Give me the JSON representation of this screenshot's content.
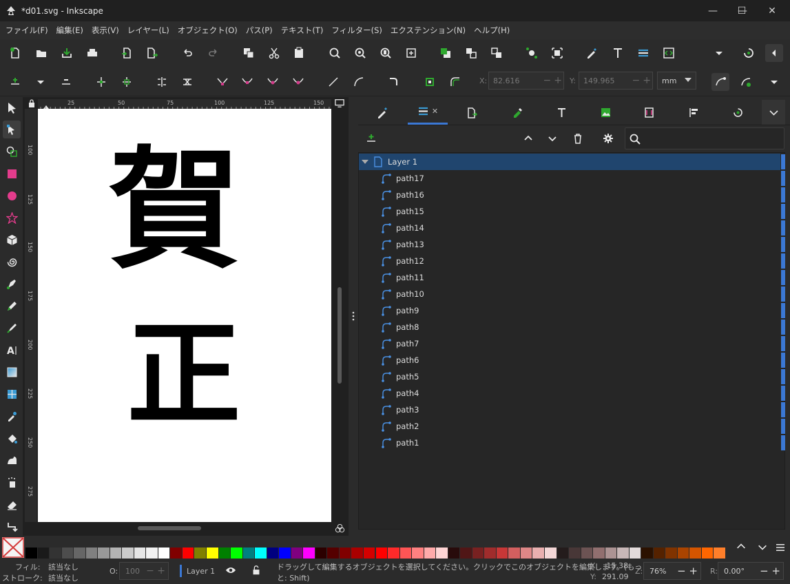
{
  "window": {
    "title": "*d01.svg - Inkscape",
    "minimize": "—",
    "maximize": "☐",
    "close": "✕"
  },
  "menu": [
    "ファイル(F)",
    "編集(E)",
    "表示(V)",
    "レイヤー(L)",
    "オブジェクト(O)",
    "パス(P)",
    "テキスト(T)",
    "フィルター(S)",
    "エクステンション(N)",
    "ヘルプ(H)"
  ],
  "controls": {
    "x_label": "X:",
    "x_value": "82.616",
    "y_label": "Y:",
    "y_value": "149.965",
    "unit": "mm"
  },
  "rulers": {
    "h_ticks": [
      "25",
      "50",
      "75",
      "100",
      "125",
      "150"
    ],
    "v_ticks": [
      "100",
      "125",
      "150",
      "175",
      "200",
      "225",
      "250",
      "275"
    ]
  },
  "canvas": {
    "glyph_top": "賀",
    "glyph_bottom": "正"
  },
  "dock": {
    "active_tab_close": "✕",
    "layer_name": "Layer 1",
    "paths": [
      "path17",
      "path16",
      "path15",
      "path14",
      "path13",
      "path12",
      "path11",
      "path10",
      "path9",
      "path8",
      "path7",
      "path6",
      "path5",
      "path4",
      "path3",
      "path2",
      "path1"
    ]
  },
  "palette": {
    "colors": [
      "#000000",
      "#1a1a1a",
      "#333333",
      "#4d4d4d",
      "#666666",
      "#808080",
      "#999999",
      "#b3b3b3",
      "#cccccc",
      "#e6e6e6",
      "#f2f2f2",
      "#ffffff",
      "#800000",
      "#ff0000",
      "#808000",
      "#ffff00",
      "#008000",
      "#00ff00",
      "#008080",
      "#00ffff",
      "#000080",
      "#0000ff",
      "#800080",
      "#ff00ff",
      "#2b0000",
      "#550000",
      "#800000",
      "#aa0000",
      "#d40000",
      "#ff0000",
      "#ff2a2a",
      "#ff5555",
      "#ff8080",
      "#ffaaaa",
      "#ffd5d5",
      "#280b0b",
      "#501616",
      "#782121",
      "#a02c2c",
      "#c83737",
      "#d35f5f",
      "#de8787",
      "#e9afaf",
      "#f4d7d7",
      "#241c1c",
      "#483737",
      "#6c5353",
      "#916f6f",
      "#ac9393",
      "#c8b7b7",
      "#e3dbdb",
      "#2b1100",
      "#552200",
      "#803300",
      "#aa4400",
      "#d45500",
      "#ff6600",
      "#ff7f2a"
    ]
  },
  "status": {
    "fill_label": "フィル:",
    "fill_value": "該当なし",
    "stroke_label": "ストローク:",
    "stroke_value": "該当なし",
    "opacity_label": "O:",
    "opacity_value": "100",
    "layer": "Layer 1",
    "message_line1": "ドラッグして編集するオブジェクトを選択してください。クリックでこのオブジェクトを編集します。(もっ",
    "message_line2": "と: Shift)",
    "x_label": "X:",
    "x_value": "15.38",
    "y_label": "Y:",
    "y_value": "291.09",
    "zoom_label": "Z:",
    "zoom_value": "76%",
    "rotate_label": "R:",
    "rotate_value": "0.00°"
  }
}
